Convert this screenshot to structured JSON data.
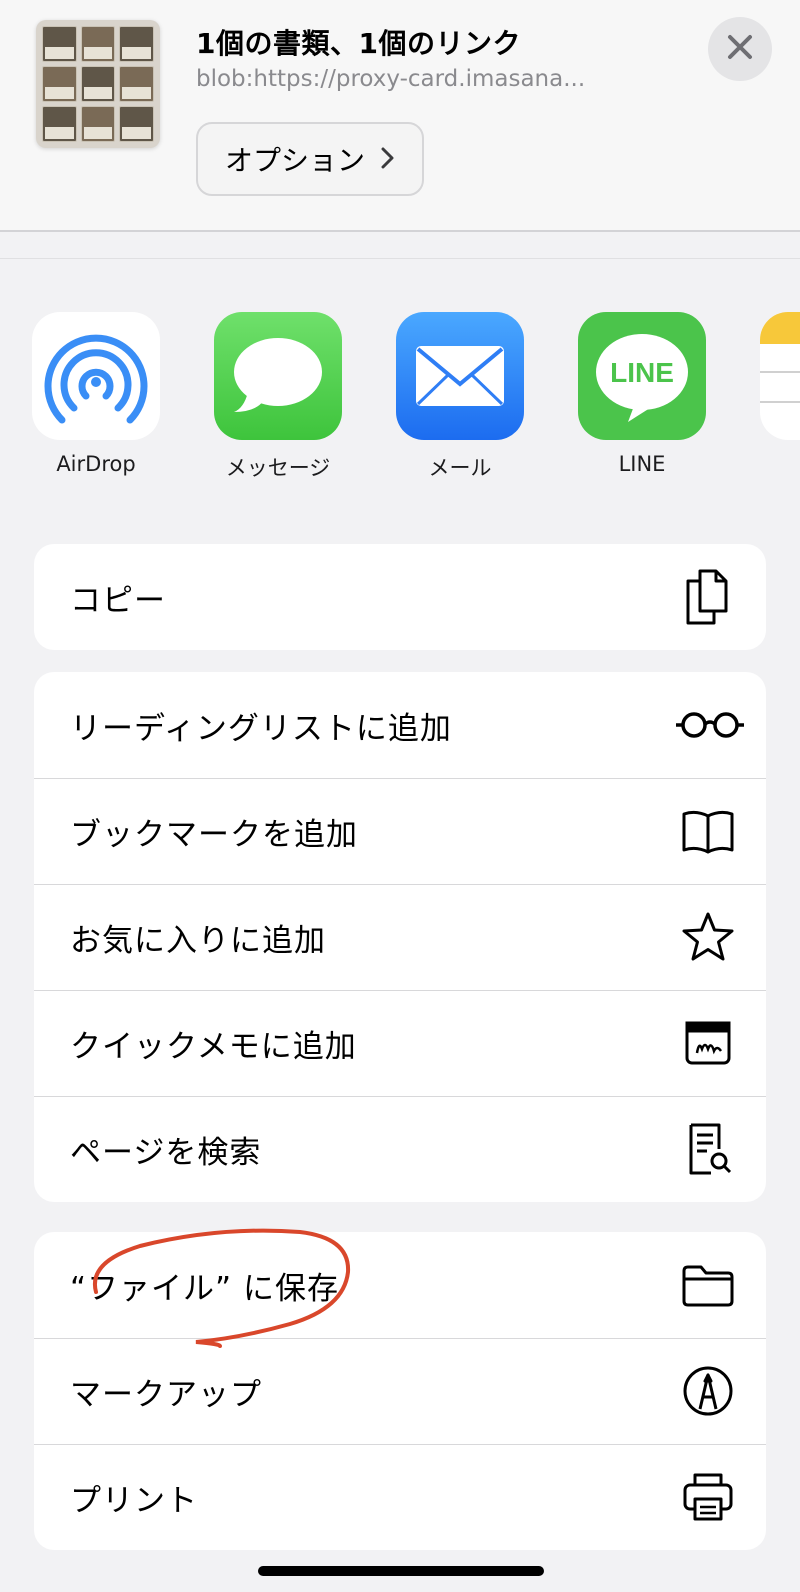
{
  "header": {
    "title": "1個の書類、1個のリンク",
    "subtitle": "blob:https://proxy-card.imasana...",
    "options_label": "オプション",
    "options_chevron": "chevron-right-icon",
    "close_icon": "close-icon"
  },
  "apps": [
    {
      "label": "AirDrop",
      "icon": "airdrop-icon"
    },
    {
      "label": "メッセージ",
      "icon": "messages-icon"
    },
    {
      "label": "メール",
      "icon": "mail-icon"
    },
    {
      "label": "LINE",
      "icon": "line-icon",
      "icon_text": "LINE"
    },
    {
      "label": "",
      "icon": "notes-icon"
    }
  ],
  "groups": [
    {
      "items": [
        {
          "label": "コピー",
          "icon": "copy-icon"
        }
      ]
    },
    {
      "items": [
        {
          "label": "リーディングリストに追加",
          "icon": "glasses-icon"
        },
        {
          "label": "ブックマークを追加",
          "icon": "book-icon"
        },
        {
          "label": "お気に入りに追加",
          "icon": "star-icon"
        },
        {
          "label": "クイックメモに追加",
          "icon": "quick-note-icon"
        },
        {
          "label": "ページを検索",
          "icon": "find-on-page-icon"
        }
      ]
    },
    {
      "items": [
        {
          "label": "“ファイル” に保存",
          "icon": "folder-icon"
        },
        {
          "label": "マークアップ",
          "icon": "markup-icon"
        },
        {
          "label": "プリント",
          "icon": "printer-icon"
        }
      ]
    }
  ],
  "colors": {
    "annotation": "#d9472b",
    "messages_green": "#5bd55a",
    "mail_blue": "#2f7ef5",
    "line_green": "#4bc44b",
    "airdrop_blue": "#3a8ef6"
  }
}
